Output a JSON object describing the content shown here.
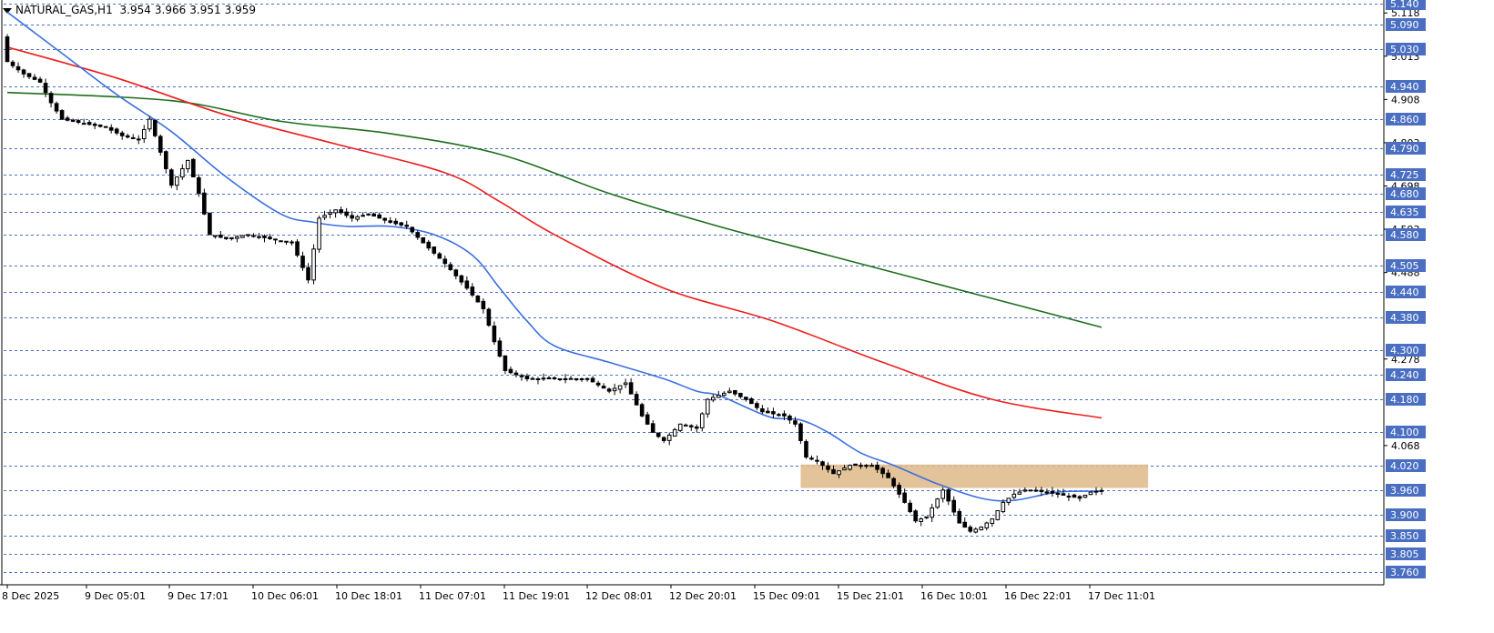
{
  "header": {
    "symbol": "NATURAL_GAS,H1",
    "open": "3.954",
    "high": "3.966",
    "low": "3.951",
    "close": "3.959"
  },
  "colors": {
    "grid": "#4a6fc2",
    "price_tag": "#4a6fc2",
    "ma_fast": "#3b6fe0",
    "ma_mid": "#ee1d1d",
    "ma_slow": "#1d6d1d",
    "zone": "#deb887"
  },
  "chart_data": {
    "type": "candlestick",
    "ylim": [
      3.73,
      5.145
    ],
    "x_tick_labels": [
      "8 Dec 2025",
      "9 Dec 05:01",
      "9 Dec 17:01",
      "10 Dec 06:01",
      "10 Dec 18:01",
      "11 Dec 07:01",
      "11 Dec 19:01",
      "12 Dec 08:01",
      "12 Dec 20:01",
      "15 Dec 09:01",
      "15 Dec 21:01",
      "16 Dec 10:01",
      "16 Dec 22:01",
      "17 Dec 11:01"
    ],
    "y_tick_labels": [
      "5.118",
      "5.013",
      "4.908",
      "4.803",
      "4.698",
      "4.593",
      "4.488",
      "4.278",
      "4.068"
    ],
    "level_lines": [
      "5.140",
      "5.090",
      "5.030",
      "4.940",
      "4.860",
      "4.790",
      "4.725",
      "4.680",
      "4.635",
      "4.580",
      "4.505",
      "4.440",
      "4.380",
      "4.300",
      "4.240",
      "4.180",
      "4.100",
      "4.020",
      "3.960",
      "3.900",
      "3.850",
      "3.805",
      "3.760"
    ],
    "zone": {
      "from_label": "15 Dec 09:01",
      "to_label": "17 Dec 11:01",
      "low": 3.965,
      "high": 4.022
    },
    "ma_fast": [
      {
        "x": 0,
        "y": 5.12
      },
      {
        "x": 10,
        "y": 5.02
      },
      {
        "x": 20,
        "y": 4.92
      },
      {
        "x": 30,
        "y": 4.83
      },
      {
        "x": 40,
        "y": 4.72
      },
      {
        "x": 50,
        "y": 4.63
      },
      {
        "x": 56,
        "y": 4.61
      },
      {
        "x": 62,
        "y": 4.6
      },
      {
        "x": 70,
        "y": 4.6
      },
      {
        "x": 78,
        "y": 4.58
      },
      {
        "x": 85,
        "y": 4.53
      },
      {
        "x": 90,
        "y": 4.45
      },
      {
        "x": 95,
        "y": 4.37
      },
      {
        "x": 100,
        "y": 4.31
      },
      {
        "x": 110,
        "y": 4.27
      },
      {
        "x": 120,
        "y": 4.23
      },
      {
        "x": 126,
        "y": 4.2
      },
      {
        "x": 130,
        "y": 4.19
      },
      {
        "x": 136,
        "y": 4.155
      },
      {
        "x": 140,
        "y": 4.135
      },
      {
        "x": 145,
        "y": 4.13
      },
      {
        "x": 150,
        "y": 4.1
      },
      {
        "x": 156,
        "y": 4.05
      },
      {
        "x": 162,
        "y": 4.02
      },
      {
        "x": 170,
        "y": 3.975
      },
      {
        "x": 178,
        "y": 3.94
      },
      {
        "x": 184,
        "y": 3.935
      },
      {
        "x": 192,
        "y": 3.955
      },
      {
        "x": 200,
        "y": 3.957
      }
    ],
    "ma_mid": [
      {
        "x": 0,
        "y": 5.035
      },
      {
        "x": 20,
        "y": 4.96
      },
      {
        "x": 40,
        "y": 4.87
      },
      {
        "x": 60,
        "y": 4.8
      },
      {
        "x": 80,
        "y": 4.73
      },
      {
        "x": 90,
        "y": 4.66
      },
      {
        "x": 100,
        "y": 4.58
      },
      {
        "x": 120,
        "y": 4.45
      },
      {
        "x": 140,
        "y": 4.37
      },
      {
        "x": 160,
        "y": 4.27
      },
      {
        "x": 180,
        "y": 4.18
      },
      {
        "x": 200,
        "y": 4.135
      }
    ],
    "ma_slow": [
      {
        "x": 0,
        "y": 4.925
      },
      {
        "x": 30,
        "y": 4.905
      },
      {
        "x": 50,
        "y": 4.855
      },
      {
        "x": 70,
        "y": 4.825
      },
      {
        "x": 90,
        "y": 4.775
      },
      {
        "x": 110,
        "y": 4.68
      },
      {
        "x": 130,
        "y": 4.6
      },
      {
        "x": 150,
        "y": 4.53
      },
      {
        "x": 170,
        "y": 4.46
      },
      {
        "x": 190,
        "y": 4.39
      },
      {
        "x": 200,
        "y": 4.355
      }
    ],
    "candles_sample": [
      {
        "x": 0,
        "o": 5.05,
        "h": 5.14,
        "l": 5.0,
        "c": 5.0
      },
      {
        "x": 20,
        "o": 4.83,
        "h": 4.86,
        "l": 4.8,
        "c": 4.82
      },
      {
        "x": 36,
        "o": 4.66,
        "h": 4.7,
        "l": 4.56,
        "c": 4.58
      },
      {
        "x": 56,
        "o": 4.5,
        "h": 4.62,
        "l": 4.46,
        "c": 4.6
      },
      {
        "x": 90,
        "o": 4.4,
        "h": 4.42,
        "l": 4.28,
        "c": 4.3
      },
      {
        "x": 118,
        "o": 4.15,
        "h": 4.2,
        "l": 4.1,
        "c": 4.11
      },
      {
        "x": 148,
        "o": 4.08,
        "h": 4.12,
        "l": 4.02,
        "c": 4.04
      },
      {
        "x": 178,
        "o": 3.9,
        "h": 3.94,
        "l": 3.85,
        "c": 3.87
      },
      {
        "x": 200,
        "o": 3.954,
        "h": 3.966,
        "l": 3.951,
        "c": 3.959
      }
    ]
  }
}
